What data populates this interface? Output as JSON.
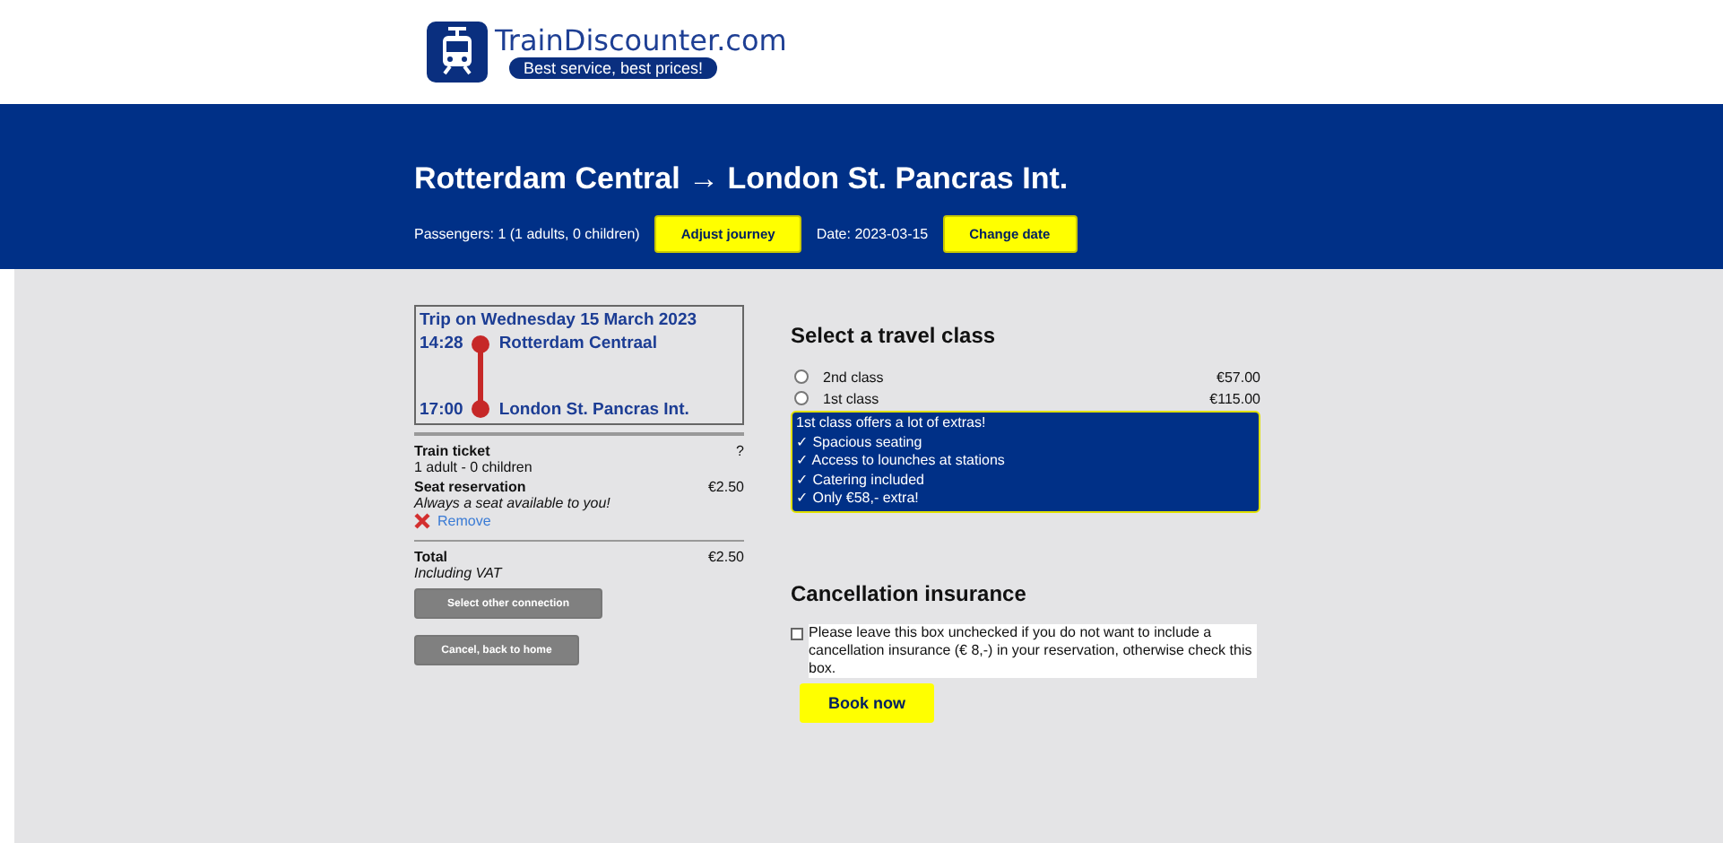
{
  "logo": {
    "name": "TrainDiscounter.com",
    "slogan": "Best service, best prices!"
  },
  "journey": {
    "title": "Rotterdam Central → London St. Pancras Int.",
    "passengers": "Passengers: 1 (1 adults, 0 children)",
    "adjust_button": "Adjust journey",
    "date": "Date: 2023-03-15",
    "change_date_button": "Change date"
  },
  "trip": {
    "heading": "Trip on Wednesday 15 March 2023",
    "departure_time": "14:28",
    "departure_station": "Rotterdam Centraal",
    "arrival_time": "17:00",
    "arrival_station": "London St. Pancras Int."
  },
  "summary": [
    {
      "kind": "item",
      "label": "Train ticket",
      "detail": "1 adult - 0 children",
      "price": "?"
    },
    {
      "kind": "item",
      "label": "Seat reservation",
      "detail": "Always a seat available to you!",
      "italic": true,
      "price": "€2.50",
      "remove": "Remove"
    }
  ],
  "total": {
    "label": "Total",
    "detail": "Including VAT",
    "price": "€2.50"
  },
  "side_buttons": [
    "Select other connection",
    "Cancel, back to home"
  ],
  "travel_class": {
    "heading": "Select a travel class",
    "options": [
      {
        "label": "2nd class",
        "price": "€57.00",
        "selected": false
      },
      {
        "label": "1st class",
        "price": "€115.00",
        "selected": false
      }
    ],
    "extras": [
      "1st class offers a lot of extras!",
      "✓ Spacious seating",
      "✓ Access to lounches at stations",
      "✓ Catering included",
      "✓ Only €58,- extra!"
    ]
  },
  "insurance": {
    "heading": "Cancellation insurance",
    "checked": false,
    "text": "Please leave this box unchecked if you do not want to include a cancellation insurance (€ 8,-) in your reservation, otherwise check this box."
  },
  "book_button": "Book now"
}
